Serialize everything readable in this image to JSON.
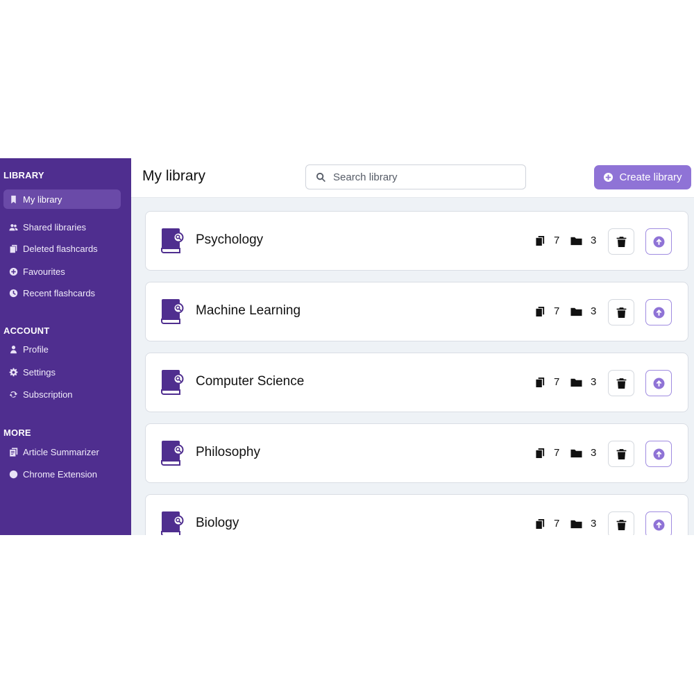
{
  "colors": {
    "sidebar_bg": "#4f2e8f",
    "sidebar_active": "#6a4aa8",
    "accent": "#8f73d6",
    "book_icon": "#4f2e8f"
  },
  "sidebar": {
    "library_heading": "LIBRARY",
    "account_heading": "ACCOUNT",
    "more_heading": "MORE",
    "library_items": [
      {
        "label": "My library",
        "icon": "bookmark-icon",
        "active": true
      },
      {
        "label": "Shared libraries",
        "icon": "users-icon"
      },
      {
        "label": "Deleted flashcards",
        "icon": "deleted-flashcards-icon"
      },
      {
        "label": "Favourites",
        "icon": "plus-circle-icon"
      },
      {
        "label": "Recent flashcards",
        "icon": "clock-icon"
      }
    ],
    "account_items": [
      {
        "label": "Profile",
        "icon": "user-icon"
      },
      {
        "label": "Settings",
        "icon": "gear-icon"
      },
      {
        "label": "Subscription",
        "icon": "refresh-icon"
      }
    ],
    "more_items": [
      {
        "label": "Article Summarizer",
        "icon": "document-icon"
      },
      {
        "label": "Chrome Extension",
        "icon": "chrome-icon"
      }
    ]
  },
  "header": {
    "title": "My library",
    "search_placeholder": "Search library",
    "create_label": "Create library"
  },
  "libraries": [
    {
      "name": "Psychology",
      "cards": "7",
      "folders": "3"
    },
    {
      "name": "Machine Learning",
      "cards": "7",
      "folders": "3"
    },
    {
      "name": "Computer Science",
      "cards": "7",
      "folders": "3"
    },
    {
      "name": "Philosophy",
      "cards": "7",
      "folders": "3"
    },
    {
      "name": "Biology",
      "cards": "7",
      "folders": "3"
    }
  ]
}
